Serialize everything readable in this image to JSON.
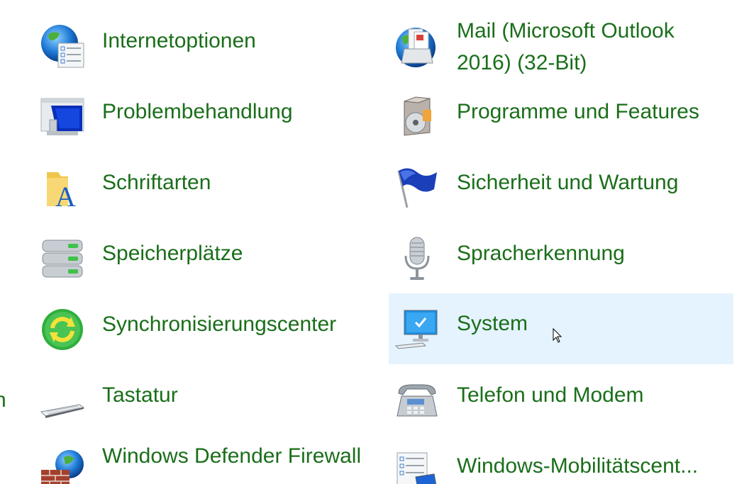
{
  "items_left": [
    {
      "label": "Internetoptionen",
      "icon": "globe-checklist-icon"
    },
    {
      "label": "Problembehandlung",
      "icon": "troubleshoot-monitor-icon"
    },
    {
      "label": "Schriftarten",
      "icon": "fonts-folder-icon"
    },
    {
      "label": "Speicherplätze",
      "icon": "storage-drives-icon"
    },
    {
      "label": "Synchronisierungscenter",
      "icon": "sync-icon"
    },
    {
      "label": "Tastatur",
      "icon": "keyboard-icon"
    },
    {
      "label": "Windows Defender Firewall",
      "icon": "firewall-icon"
    }
  ],
  "items_right": [
    {
      "label": "Mail (Microsoft Outlook 2016) (32-Bit)",
      "icon": "mail-icon"
    },
    {
      "label": "Programme und Features",
      "icon": "programs-box-icon"
    },
    {
      "label": "Sicherheit und Wartung",
      "icon": "flag-icon"
    },
    {
      "label": "Spracherkennung",
      "icon": "microphone-icon"
    },
    {
      "label": "System",
      "icon": "computer-check-icon"
    },
    {
      "label": "Telefon und Modem",
      "icon": "telephone-icon"
    },
    {
      "label": "Windows-Mobilitätscent...",
      "icon": "mobility-center-icon"
    }
  ],
  "edge_fragment": "n",
  "selected_item": "System",
  "colors": {
    "label_text": "#1a6e1a",
    "selected_background": "#e5f3ff"
  }
}
